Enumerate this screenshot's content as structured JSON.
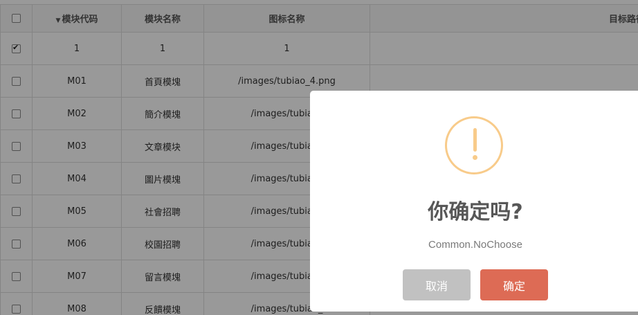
{
  "table": {
    "headers": {
      "code": "模块代码",
      "name": "模块名称",
      "icon": "图标名称",
      "target": "目标路径"
    },
    "rows": [
      {
        "checked": true,
        "code": "1",
        "name": "1",
        "icon": "1"
      },
      {
        "checked": false,
        "code": "M01",
        "name": "首頁模塊",
        "icon": "/images/tubiao_4.png"
      },
      {
        "checked": false,
        "code": "M02",
        "name": "簡介模塊",
        "icon": "/images/tubiao_"
      },
      {
        "checked": false,
        "code": "M03",
        "name": "文章模块",
        "icon": "/images/tubiao_"
      },
      {
        "checked": false,
        "code": "M04",
        "name": "圖片模塊",
        "icon": "/images/tubiao_"
      },
      {
        "checked": false,
        "code": "M05",
        "name": "社會招聘",
        "icon": "/images/tubiao_"
      },
      {
        "checked": false,
        "code": "M06",
        "name": "校園招聘",
        "icon": "/images/tubiao_"
      },
      {
        "checked": false,
        "code": "M07",
        "name": "留言模塊",
        "icon": "/images/tubiao_"
      },
      {
        "checked": false,
        "code": "M08",
        "name": "反饋模塊",
        "icon": "/images/tubiao_"
      }
    ]
  },
  "dialog": {
    "icon": "warning-icon",
    "title": "你确定吗?",
    "text": "Common.NoChoose",
    "cancel_label": "取消",
    "confirm_label": "确定"
  },
  "colors": {
    "warning": "#f8cb8a",
    "confirm": "#dd6b55",
    "cancel": "#c1c1c1"
  }
}
